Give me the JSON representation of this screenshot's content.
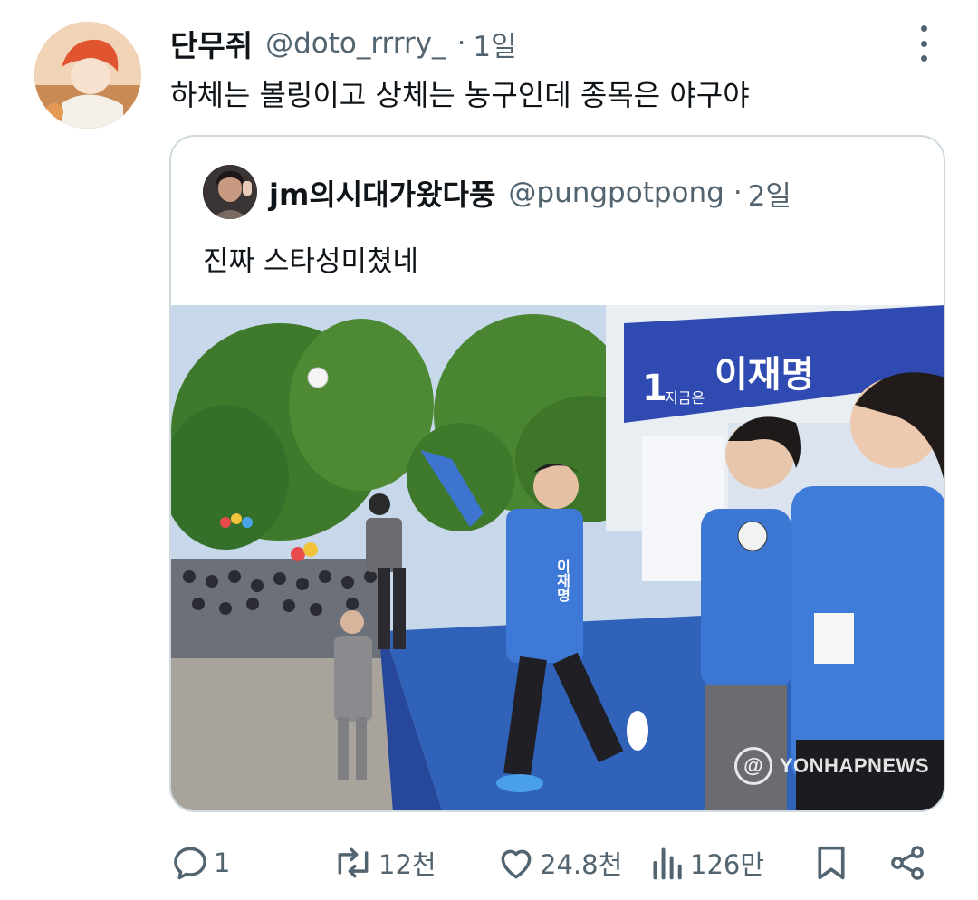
{
  "tweet": {
    "display_name": "단무쥐",
    "handle": "@doto_rrrry_",
    "separator": "·",
    "time": "1일",
    "text": "하체는 볼링이고 상체는 농구인데 종목은 야구야"
  },
  "quoted_tweet": {
    "display_name": "jm의시대가왔다풍",
    "handle": "@pungpotpong",
    "separator": "·",
    "time": "2일",
    "text": "진짜 스타성미쳤네",
    "photo": {
      "banner_text": "이재명",
      "banner_small": "지금은",
      "banner_number": "1",
      "vest_text": "이재명",
      "watermark": "YONHAPNEWS"
    }
  },
  "actions": {
    "reply_count": "1",
    "retweet_count": "12천",
    "like_count": "24.8천",
    "view_count": "126만"
  },
  "icons": [
    "more-icon",
    "reply-icon",
    "retweet-icon",
    "like-icon",
    "views-icon",
    "bookmark-icon",
    "share-icon"
  ],
  "colors": {
    "text": "#0f1419",
    "secondary": "#536471",
    "border": "#cfd9de"
  }
}
